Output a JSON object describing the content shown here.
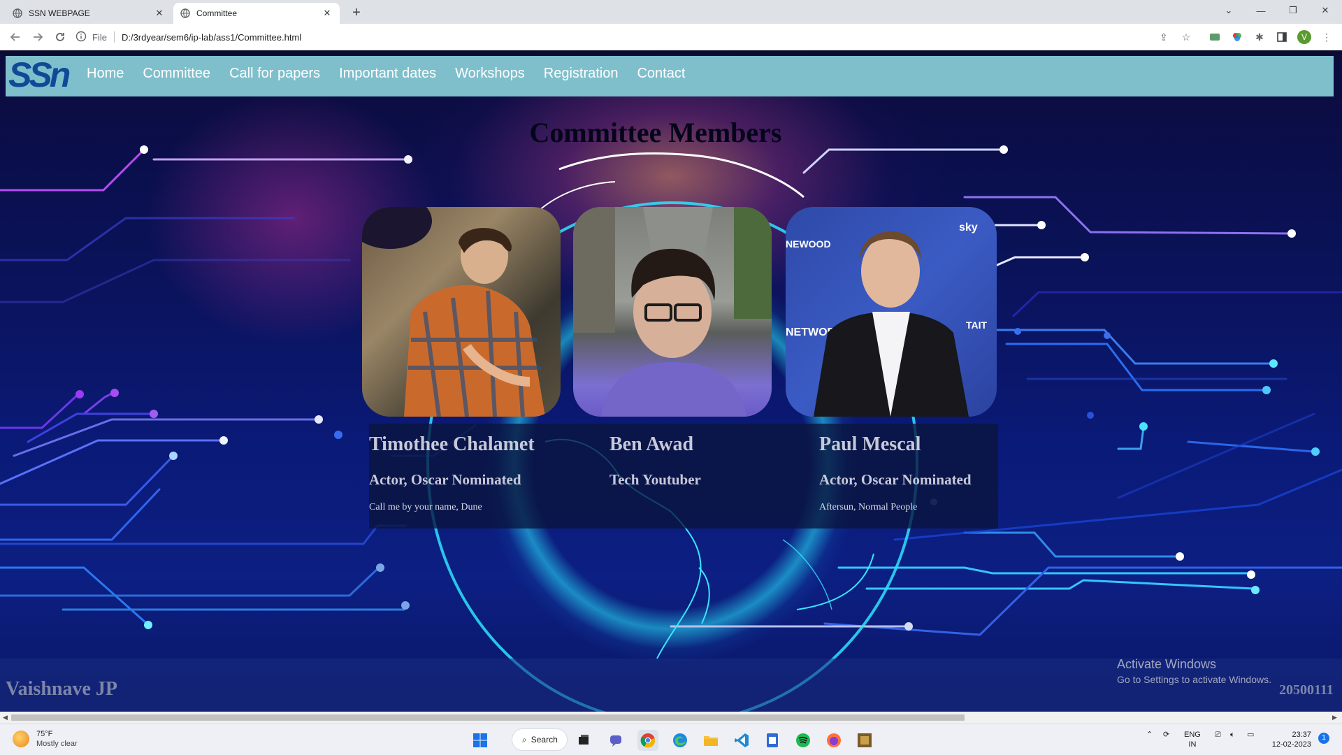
{
  "browser": {
    "tabs": [
      {
        "title": "SSN WEBPAGE",
        "active": false
      },
      {
        "title": "Committee",
        "active": true
      }
    ],
    "new_tab_icon": "plus-icon",
    "address": {
      "scheme_label": "File",
      "url": "D:/3rdyear/sem6/ip-lab/ass1/Committee.html"
    },
    "profile_initial": "V"
  },
  "site": {
    "logo_text": "SSn",
    "nav": [
      "Home",
      "Committee",
      "Call for papers",
      "Important dates",
      "Workshops",
      "Registration",
      "Contact"
    ],
    "title": "Committee Members",
    "members": [
      {
        "name": "Timothee Chalamet",
        "role": "Actor, Oscar Nominated",
        "works": "Call me by your name, Dune"
      },
      {
        "name": "Ben Awad",
        "role": "Tech Youtuber",
        "works": ""
      },
      {
        "name": "Paul Mescal",
        "role": "Actor, Oscar Nominated",
        "works": "Aftersun, Normal People"
      }
    ],
    "footer": {
      "name": "Vaishnave JP",
      "roll": "20500111"
    }
  },
  "watermark": {
    "line1": "Activate Windows",
    "line2": "Go to Settings to activate Windows."
  },
  "taskbar": {
    "weather": {
      "temp": "75°F",
      "desc": "Mostly clear"
    },
    "search_label": "Search",
    "tray": {
      "lang": "ENG",
      "region": "IN",
      "time": "23:37",
      "date": "12-02-2023",
      "notifications": "1"
    }
  },
  "colors": {
    "nav_bar": "#7fbfcc",
    "page_bg": "#0a1460",
    "glow": "#28e6ff"
  }
}
